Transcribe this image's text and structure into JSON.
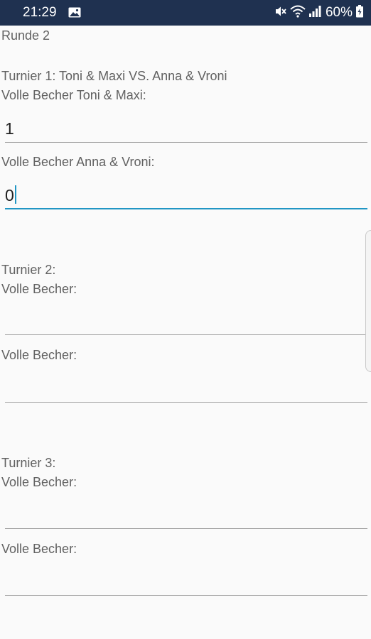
{
  "status_bar": {
    "time": "21:29",
    "battery": "60%",
    "icons": [
      "gallery-icon",
      "mute-icon",
      "wifi-icon",
      "signal-icon",
      "battery-icon"
    ]
  },
  "round_title": "Runde 2",
  "tournaments": [
    {
      "title": "Turnier 1: Toni & Maxi VS. Anna & Vroni",
      "label_a": "Volle Becher Toni & Maxi:",
      "value_a": "1",
      "label_b": "Volle Becher Anna & Vroni:",
      "value_b": "0"
    },
    {
      "title": "Turnier 2:",
      "label_a": "Volle Becher:",
      "value_a": "",
      "label_b": "Volle Becher:",
      "value_b": ""
    },
    {
      "title": "Turnier 3:",
      "label_a": "Volle Becher:",
      "value_a": "",
      "label_b": "Volle Becher:",
      "value_b": ""
    }
  ],
  "colors": {
    "status_bar": "#1f3150",
    "accent": "#2196c4",
    "text": "#616161",
    "background": "#fafafa"
  }
}
